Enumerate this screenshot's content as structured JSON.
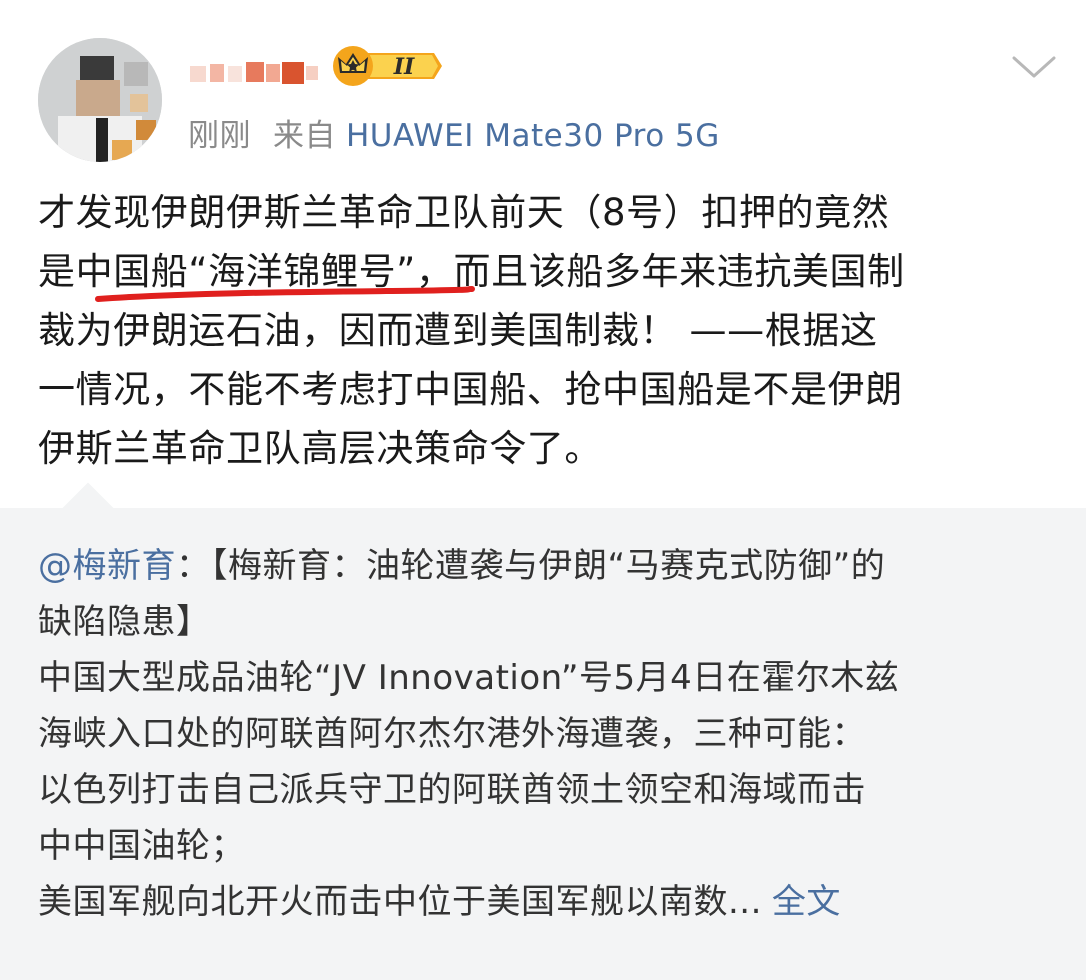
{
  "post": {
    "timestamp": "刚刚",
    "source_prefix": "来自",
    "source_device": "HUAWEI Mate30 Pro 5G",
    "badge_level": "II",
    "body_lines": [
      "才发现伊朗伊斯兰革命卫队前天（8号）扣押的竟然",
      "是中国船“海洋锦鲤号”，而且该船多年来违抗美国制",
      "裁为伊朗运石油，因而遭到美国制裁！ ——根据这",
      "一情况，不能不考虑打中国船、抢中国船是不是伊朗",
      "伊斯兰革命卫队高层决策命令了。"
    ]
  },
  "quoted": {
    "mention": "@梅新育",
    "first_line_rest": "：【梅新育：油轮遭袭与伊朗“马赛克式防御”的",
    "lines": [
      "缺陷隐患】",
      "中国大型成品油轮“JV Innovation”号5月4日在霍尔木兹",
      "海峡入口处的阿联酋阿尔杰尔港外海遭袭，三种可能：",
      "以色列打击自己派兵守卫的阿联酋领土领空和海域而击",
      "中中国油轮；"
    ],
    "last_line": "美国军舰向北开火而击中位于美国军舰以南数...",
    "full_text_link": "全文"
  },
  "colors": {
    "link": "#4a6fa0",
    "underline": "#e0201e",
    "quote_bg": "#f3f4f5",
    "meta_gray": "#8a8a8a",
    "badge_gold": "#f4a51c"
  },
  "icons": {
    "more": "chevron-down-icon",
    "badge": "crown-badge-icon"
  }
}
